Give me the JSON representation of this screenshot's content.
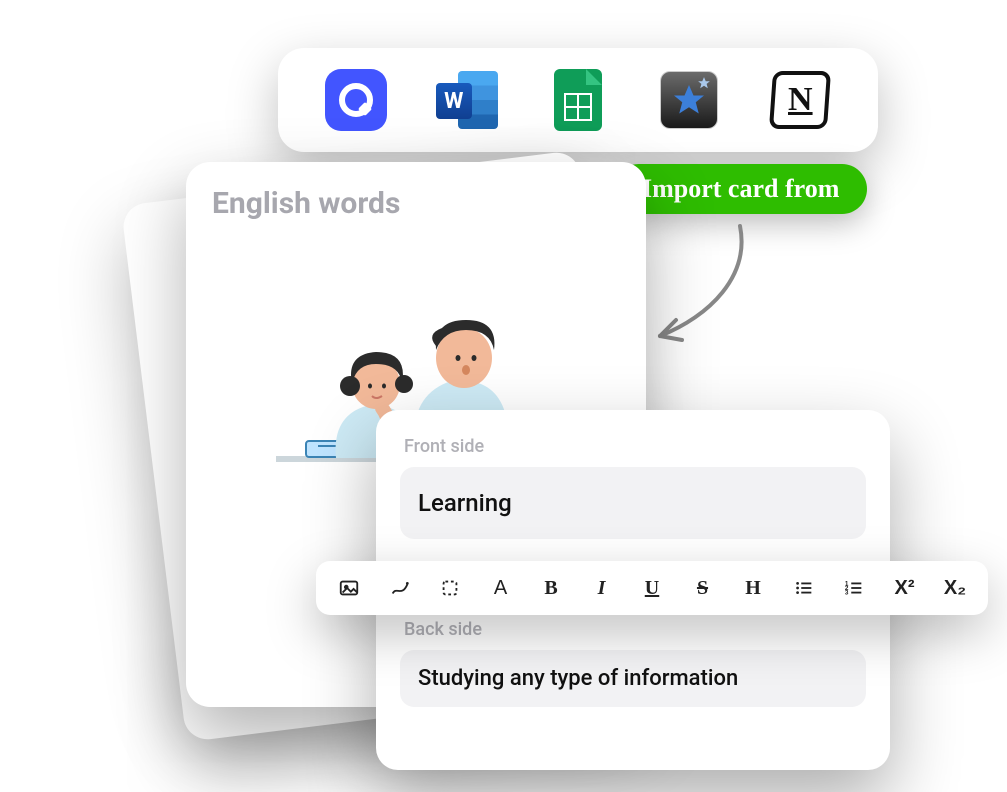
{
  "importBar": {
    "sources": [
      {
        "name": "quizlet",
        "label": "Q"
      },
      {
        "name": "word",
        "label": "W"
      },
      {
        "name": "sheets",
        "label": ""
      },
      {
        "name": "anki",
        "label": ""
      },
      {
        "name": "notion",
        "label": "N"
      }
    ]
  },
  "callout": {
    "text": "Import card from"
  },
  "card": {
    "title": "English words"
  },
  "editor": {
    "frontLabel": "Front side",
    "frontValue": "Learning",
    "backLabel": "Back side",
    "backValue": "Studying any type of information"
  },
  "toolbar": {
    "buttons": [
      {
        "name": "image",
        "glyph": ""
      },
      {
        "name": "draw",
        "glyph": ""
      },
      {
        "name": "select",
        "glyph": ""
      },
      {
        "name": "font",
        "glyph": "A"
      },
      {
        "name": "bold",
        "glyph": "B"
      },
      {
        "name": "italic",
        "glyph": "I"
      },
      {
        "name": "underline",
        "glyph": "U"
      },
      {
        "name": "strike",
        "glyph": "S"
      },
      {
        "name": "heading",
        "glyph": "H"
      },
      {
        "name": "bullet-list",
        "glyph": ""
      },
      {
        "name": "number-list",
        "glyph": ""
      },
      {
        "name": "superscript",
        "glyph": "X²"
      },
      {
        "name": "subscript",
        "glyph": "X₂"
      }
    ]
  }
}
